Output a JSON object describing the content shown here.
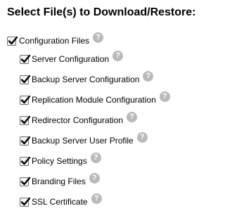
{
  "heading": "Select File(s) to Download/Restore:",
  "help_glyph": "?",
  "icons": {
    "checkbox": "checkmark-icon",
    "help": "question-mark-help-icon"
  },
  "colors": {
    "help_icon_bg": "#b9b9b9",
    "checkbox_border": "#6b6b6b",
    "checkmark": "#000000"
  },
  "tree": {
    "root": {
      "label": "Configuration Files",
      "checked": true
    },
    "children": [
      {
        "label": "Server Configuration",
        "checked": true
      },
      {
        "label": "Backup Server Configuration",
        "checked": true
      },
      {
        "label": "Replication Module Configuration",
        "checked": true
      },
      {
        "label": "Redirector Configuration",
        "checked": true
      },
      {
        "label": "Backup Server User Profile",
        "checked": true
      },
      {
        "label": "Policy Settings",
        "checked": true
      },
      {
        "label": "Branding Files",
        "checked": true
      },
      {
        "label": "SSL Certificate",
        "checked": true
      }
    ]
  }
}
